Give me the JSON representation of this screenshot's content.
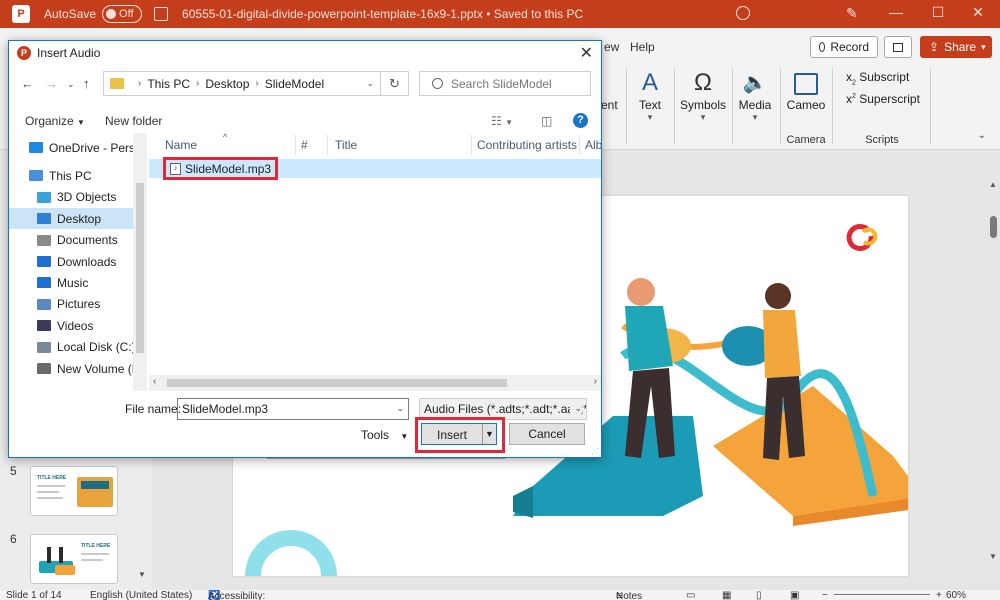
{
  "window": {
    "autosave_label": "AutoSave",
    "autosave_state": "Off",
    "file_title": "60555-01-digital-divide-powerpoint-template-16x9-1.pptx  •  Saved to this PC",
    "minimize": "—",
    "restore": "☐",
    "close": "✕"
  },
  "ribbon": {
    "tab_partial": "ew",
    "tab_help": "Help",
    "record_label": "Record",
    "share_label": "Share",
    "partial_item": "ent",
    "text_label": "Text",
    "symbols_label": "Symbols",
    "media_label": "Media",
    "cameo_label": "Cameo",
    "camera_group": "Camera",
    "subscript_label": "Subscript",
    "superscript_label": "Superscript",
    "scripts_group": "Scripts",
    "x_sub": "x",
    "sub_mark": "2",
    "x_sup": "x",
    "sup_mark": "2"
  },
  "thumbnails": [
    {
      "number": "5",
      "title": "TITLE HERE"
    },
    {
      "number": "6",
      "title": "TITLE HERE"
    }
  ],
  "statusbar": {
    "slide_info": "Slide 1 of 14",
    "language": "English (United States)",
    "accessibility": "Accessibility: Investigate",
    "notes": "Notes",
    "zoom": "60%"
  },
  "dialog": {
    "title": "Insert Audio",
    "path": [
      "This PC",
      "Desktop",
      "SlideModel"
    ],
    "search_placeholder": "Search SlideModel",
    "organize_label": "Organize",
    "new_folder_label": "New folder",
    "nav_items": [
      {
        "label": "OneDrive - Persor",
        "indent": 0,
        "color": "#1e88e5"
      },
      {
        "label": "This PC",
        "indent": 0,
        "color": "#4a90d9"
      },
      {
        "label": "3D Objects",
        "indent": 1,
        "color": "#3aa0d8"
      },
      {
        "label": "Desktop",
        "indent": 1,
        "color": "#2f7fd6",
        "selected": true
      },
      {
        "label": "Documents",
        "indent": 1,
        "color": "#8a8a8a"
      },
      {
        "label": "Downloads",
        "indent": 1,
        "color": "#1e6fd0"
      },
      {
        "label": "Music",
        "indent": 1,
        "color": "#1e6fd0"
      },
      {
        "label": "Pictures",
        "indent": 1,
        "color": "#5a8ac0"
      },
      {
        "label": "Videos",
        "indent": 1,
        "color": "#3a3a5a"
      },
      {
        "label": "Local Disk (C:)",
        "indent": 1,
        "color": "#7a8a9a"
      },
      {
        "label": "New Volume (D:",
        "indent": 1,
        "color": "#6a6a6a"
      }
    ],
    "columns": [
      "Name",
      "#",
      "Title",
      "Contributing artists",
      "Albums"
    ],
    "files": [
      {
        "name": "SlideModel.mp3"
      }
    ],
    "file_name_label": "File name:",
    "file_name_value": "SlideModel.mp3",
    "file_type_value": "Audio Files (*.adts;*.adt;*.aac;*.",
    "tools_label": "Tools",
    "insert_label": "Insert",
    "cancel_label": "Cancel"
  }
}
